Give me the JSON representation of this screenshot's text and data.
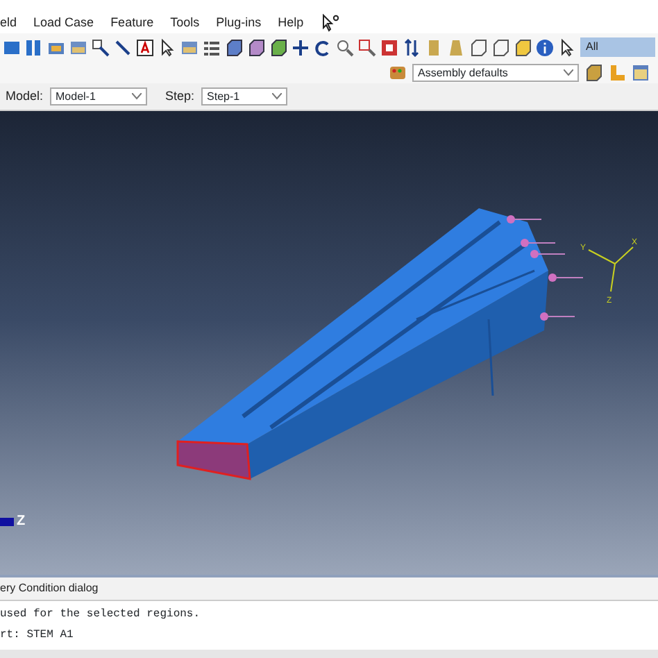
{
  "menu_bar": [
    {
      "label": "eld"
    },
    {
      "label": "Load Case"
    },
    {
      "label": "Feature"
    },
    {
      "label": "Tools"
    },
    {
      "label": "Plug-ins"
    },
    {
      "label": "Help"
    }
  ],
  "toolbar": {
    "selection_filter": "All",
    "render_style": "Assembly defaults"
  },
  "context_bar": {
    "model_label": "Model:",
    "model": "Model-1",
    "step_label": "Step:",
    "step": "Step-1"
  },
  "viewport": {
    "triad_labels": [
      "Y",
      "X",
      "Z"
    ],
    "corner_triad_label": "Z"
  },
  "prompt": "ery Condition dialog",
  "messages": [
    "used for the selected regions.",
    "rt: STEM A1"
  ]
}
